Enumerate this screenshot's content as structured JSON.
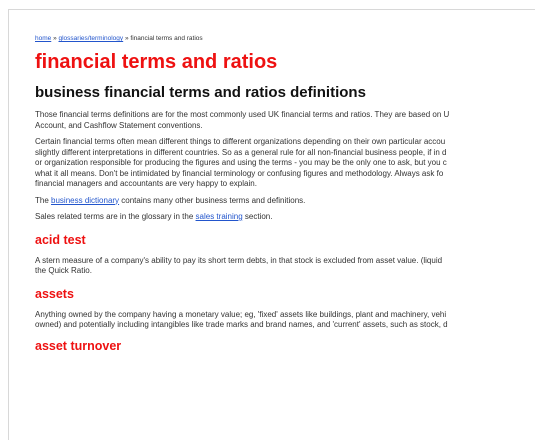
{
  "breadcrumb": {
    "home": "home",
    "sep1": " » ",
    "glossary": "glossaries/terminology",
    "sep2": " » ",
    "current": "financial terms and ratios"
  },
  "title": "financial terms and ratios",
  "subtitle": "business financial terms and ratios definitions",
  "intro": {
    "p1_l1": "Those financial terms definitions are for the most commonly used UK financial terms and ratios. They are based on U",
    "p1_l2": "Account, and Cashflow Statement conventions.",
    "p2_l1": "Certain financial terms often mean different things to different organizations depending on their own particular accou",
    "p2_l2": "slightly different interpretations in different countries. So as a general rule for all non-financial business people, if in d",
    "p2_l3": "or organization responsible for producing the figures and using the terms - you may be the only one to ask, but you c",
    "p2_l4": "what it all means. Don't be intimidated by financial terminology or confusing figures and methodology. Always ask fo",
    "p2_l5": "financial managers and accountants are very happy to explain.",
    "p3_pre": "The ",
    "p3_link": "business dictionary",
    "p3_post": " contains many other business terms and definitions.",
    "p4_pre": "Sales related terms are in the glossary in the ",
    "p4_link": "sales training",
    "p4_post": " section."
  },
  "terms": [
    {
      "heading": "acid test",
      "l1": "A stern measure of a company's ability to pay its short term debts, in that stock is excluded from asset value. (liquid",
      "l2": "the Quick Ratio."
    },
    {
      "heading": "assets",
      "l1": "Anything owned by the company having a monetary value; eg, 'fixed' assets like buildings, plant and machinery, vehi",
      "l2": "owned) and potentially including intangibles like trade marks and brand names, and 'current' assets, such as stock, d"
    },
    {
      "heading": "asset turnover"
    }
  ]
}
